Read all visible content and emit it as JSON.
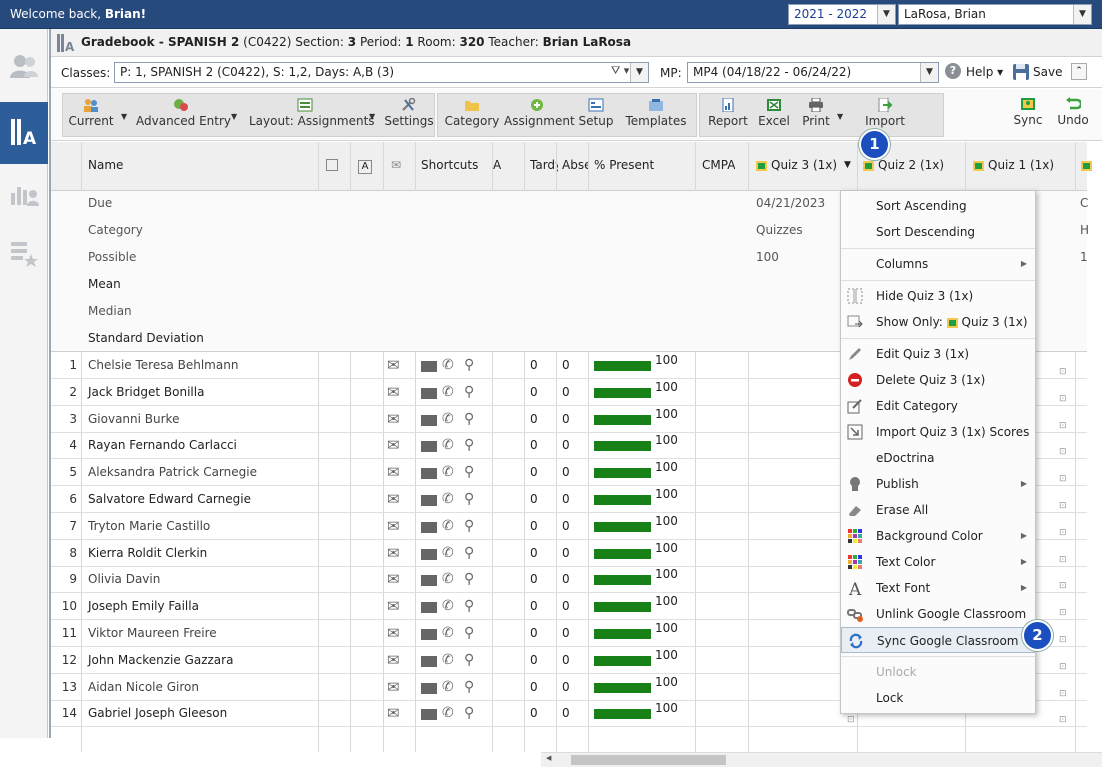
{
  "topbar": {
    "welcome_prefix": "Welcome back, ",
    "user_name": "Brian!",
    "year": "2021 - 2022",
    "teacher": "LaRosa, Brian"
  },
  "title": {
    "app": "Gradebook - SPANISH 2",
    "course_code": "(C0422)",
    "section_label": "Section:",
    "section": "3",
    "period_label": "Period:",
    "period": "1",
    "room_label": "Room:",
    "room": "320",
    "teacher_label": "Teacher:",
    "teacher": "Brian LaRosa"
  },
  "classes": {
    "label": "Classes:",
    "value": "P: 1, SPANISH 2 (C0422), S: 1,2, Days: A,B (3)",
    "mp_label": "MP:",
    "mp_value": "MP4 (04/18/22 - 06/24/22)",
    "help": "Help",
    "save": "Save"
  },
  "toolbar": {
    "current": "Current",
    "advanced_entry": "Advanced Entry",
    "layout": "Layout: Assignments",
    "settings": "Settings",
    "category": "Category",
    "assignment": "Assignment",
    "setup": "Setup",
    "templates": "Templates",
    "report": "Report",
    "excel": "Excel",
    "print": "Print",
    "import": "Import",
    "sync": "Sync",
    "undo": "Undo"
  },
  "columns": {
    "name": "Name",
    "shortcuts": "Shortcuts",
    "a": "A",
    "tardy": "Tardy",
    "absent": "Abse",
    "present": "% Present",
    "cmpa": "CMPA",
    "quiz3": "Quiz 3 (1x)",
    "quiz2": "Quiz 2 (1x)",
    "quiz1": "Quiz 1 (1x)",
    "a_icon": "A"
  },
  "info_rows": {
    "due": "Due",
    "category": "Category",
    "possible": "Possible",
    "mean": "Mean",
    "median": "Median",
    "std": "Standard Deviation",
    "quiz3_due": "04/21/2023",
    "quiz3_category": "Quizzes",
    "quiz3_possible": "100",
    "edge_c": "C",
    "edge_h": "H",
    "edge_1": "1"
  },
  "students": [
    {
      "n": "1",
      "name": "Chelsie Teresa Behlmann",
      "t": "0",
      "a": "0",
      "p": "100",
      "gray": true
    },
    {
      "n": "2",
      "name": "Jack Bridget Bonilla",
      "t": "0",
      "a": "0",
      "p": "100",
      "gray": false
    },
    {
      "n": "3",
      "name": "Giovanni Burke",
      "t": "0",
      "a": "0",
      "p": "100",
      "gray": true
    },
    {
      "n": "4",
      "name": "Rayan Fernando Carlacci",
      "t": "0",
      "a": "0",
      "p": "100",
      "gray": false
    },
    {
      "n": "5",
      "name": "Aleksandra Patrick Carnegie",
      "t": "0",
      "a": "0",
      "p": "100",
      "gray": true
    },
    {
      "n": "6",
      "name": "Salvatore Edward Carnegie",
      "t": "0",
      "a": "0",
      "p": "100",
      "gray": false
    },
    {
      "n": "7",
      "name": "Tryton Marie Castillo",
      "t": "0",
      "a": "0",
      "p": "100",
      "gray": true
    },
    {
      "n": "8",
      "name": "Kierra Roldit Clerkin",
      "t": "0",
      "a": "0",
      "p": "100",
      "gray": false
    },
    {
      "n": "9",
      "name": "Olivia Davin",
      "t": "0",
      "a": "0",
      "p": "100",
      "gray": true
    },
    {
      "n": "10",
      "name": "Joseph Emily Failla",
      "t": "0",
      "a": "0",
      "p": "100",
      "gray": false
    },
    {
      "n": "11",
      "name": "Viktor Maureen Freire",
      "t": "0",
      "a": "0",
      "p": "100",
      "gray": true
    },
    {
      "n": "12",
      "name": "John Mackenzie Gazzara",
      "t": "0",
      "a": "0",
      "p": "100",
      "gray": false
    },
    {
      "n": "13",
      "name": "Aidan Nicole Giron",
      "t": "0",
      "a": "0",
      "p": "100",
      "gray": true
    },
    {
      "n": "14",
      "name": "Gabriel Joseph Gleeson",
      "t": "0",
      "a": "0",
      "p": "100",
      "gray": false
    }
  ],
  "menu": {
    "sort_asc": "Sort Ascending",
    "sort_desc": "Sort Descending",
    "columns": "Columns",
    "hide": "Hide Quiz 3 (1x)",
    "show_only": "Show Only:",
    "show_only_target": "Quiz 3 (1x)",
    "edit": "Edit Quiz 3 (1x)",
    "delete": "Delete Quiz 3 (1x)",
    "edit_category": "Edit Category",
    "import_scores": "Import Quiz 3 (1x) Scores",
    "edoctrina": "eDoctrina",
    "publish": "Publish",
    "erase_all": "Erase All",
    "bg_color": "Background Color",
    "text_color": "Text Color",
    "text_font": "Text Font",
    "unlink": "Unlink Google Classroom",
    "sync": "Sync Google Classroom",
    "unlock": "Unlock",
    "lock": "Lock"
  },
  "callouts": {
    "one": "1",
    "two": "2"
  },
  "colors": {
    "topbar": "#274a7c",
    "active_nav": "#2d5e9a",
    "present_bar": "#178117",
    "callout": "#1b4fbf"
  }
}
